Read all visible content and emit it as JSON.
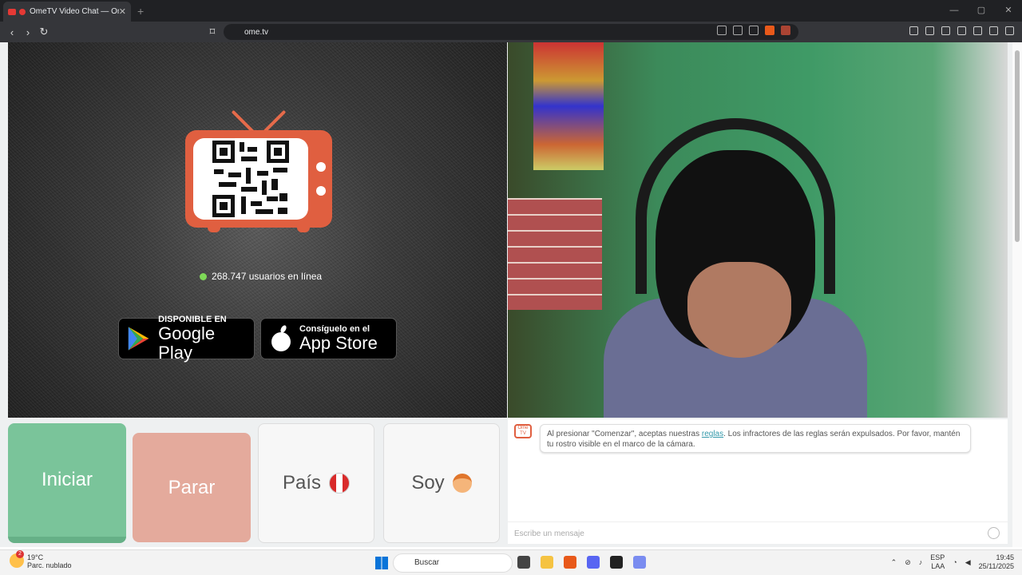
{
  "browser": {
    "tab_title": "OmeTV Video Chat — Omeg",
    "new_tab": "+",
    "url": "ome.tv",
    "window_controls": [
      "—",
      "▢",
      "✕"
    ]
  },
  "left_panel": {
    "online_count": "268.747 usuarios en línea",
    "google_play": {
      "small": "DISPONIBLE EN",
      "big": "Google Play"
    },
    "app_store": {
      "small": "Consíguelo en el",
      "big": "App Store"
    }
  },
  "controls": {
    "start": "Iniciar",
    "stop": "Parar",
    "country": "País",
    "gender": "Soy"
  },
  "chat": {
    "logo": "Ome TV",
    "notice_before": "Al presionar \"Comenzar\", aceptas nuestras ",
    "notice_link": "reglas",
    "notice_after": ". Los infractores de las reglas serán expulsados. Por favor, mantén tu rostro visible en el marco de la cámara.",
    "input_placeholder": "Escribe un mensaje"
  },
  "taskbar": {
    "weather_temp": "19°C",
    "weather_desc": "Parc. nublado",
    "weather_badge": "2",
    "search_placeholder": "Buscar",
    "lang1": "ESP",
    "lang2": "LAA",
    "time": "19:45",
    "date": "25/11/2025"
  }
}
